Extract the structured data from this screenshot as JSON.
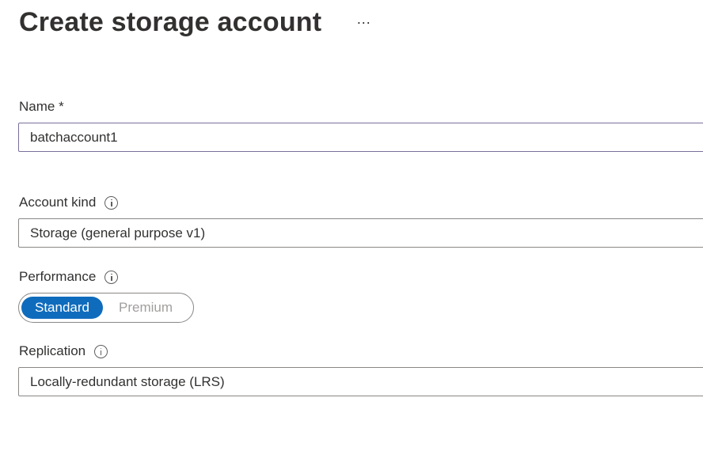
{
  "header": {
    "title": "Create storage account",
    "more": "···"
  },
  "name_field": {
    "label": "Name *",
    "value": "batchaccount1"
  },
  "account_kind": {
    "label": "Account kind",
    "value": "Storage (general purpose v1)"
  },
  "performance": {
    "label": "Performance",
    "options": [
      "Standard",
      "Premium"
    ],
    "selected": "Standard"
  },
  "replication": {
    "label": "Replication",
    "value": "Locally-redundant storage (LRS)"
  },
  "colors": {
    "accent": "#0f6cbd",
    "text": "#323130",
    "border": "#8a8886",
    "muted": "#a19f9d"
  }
}
